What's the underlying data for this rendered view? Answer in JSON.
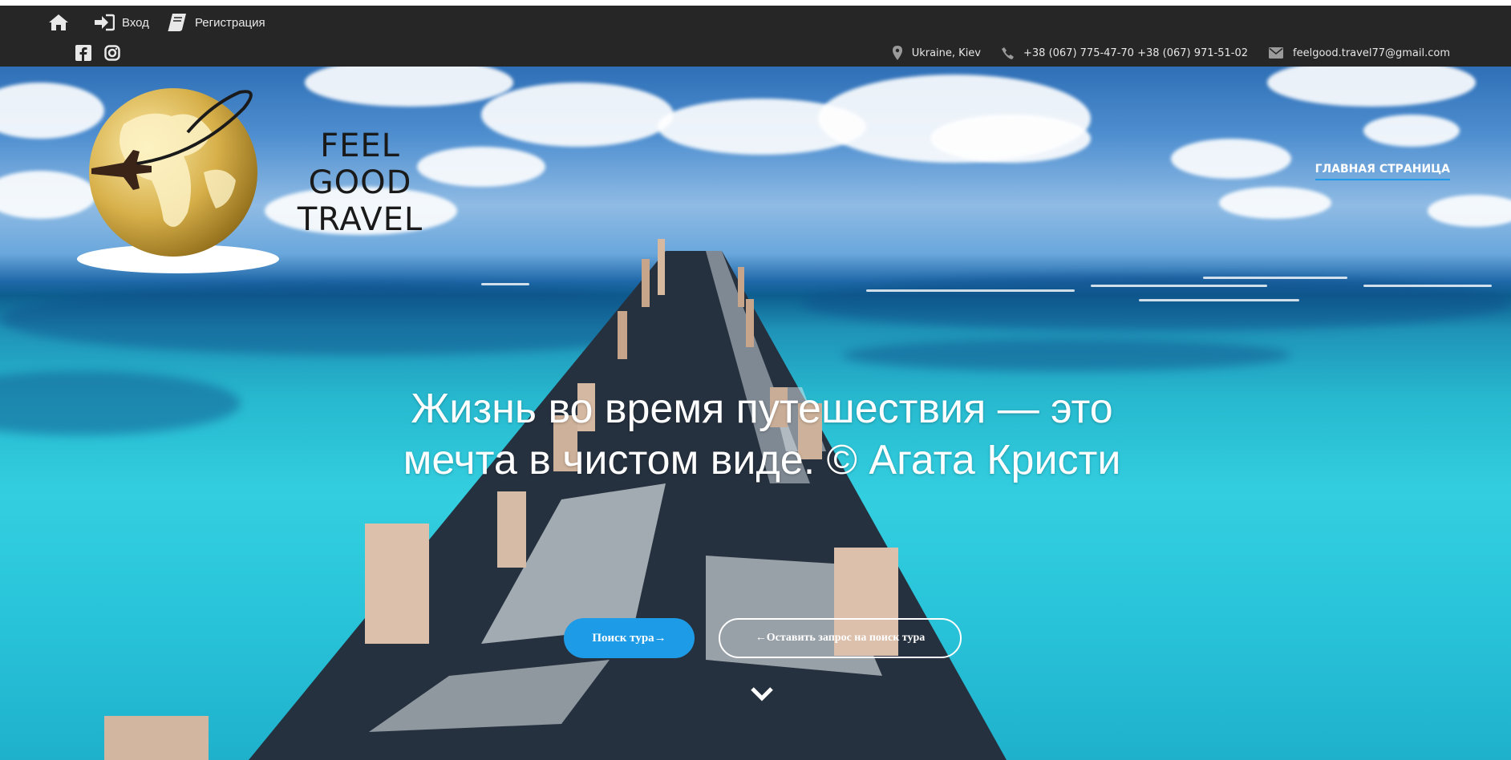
{
  "topbar": {
    "nav": [
      {
        "icon": "home-icon",
        "label": ""
      },
      {
        "icon": "sign-in-icon",
        "label": "Вход"
      },
      {
        "icon": "book-icon",
        "label": "Регистрация"
      }
    ],
    "social": [
      {
        "icon": "facebook-icon"
      },
      {
        "icon": "instagram-icon"
      }
    ],
    "contacts": {
      "location": "Ukraine, Kiev",
      "phones": "+38 (067) 775-47-70 +38 (067) 971-51-02",
      "email": "feelgood.travel77@gmail.com"
    }
  },
  "logo": {
    "line1": "FEEL GOOD",
    "line2": "TRAVEL"
  },
  "nav": {
    "home_label": "ГЛАВНАЯ СТРАНИЦА"
  },
  "hero": {
    "quote": "Жизнь во время путешествия — это мечта в чистом виде. © Агата Кристи",
    "search_button": "Поиск тура→",
    "request_button": "←Оставить запрос на поиск тура"
  },
  "colors": {
    "topbar": "#262626",
    "accent": "#1e9be6",
    "text_light": "#e8e8e8",
    "logo_gold": "#d7b04a"
  }
}
